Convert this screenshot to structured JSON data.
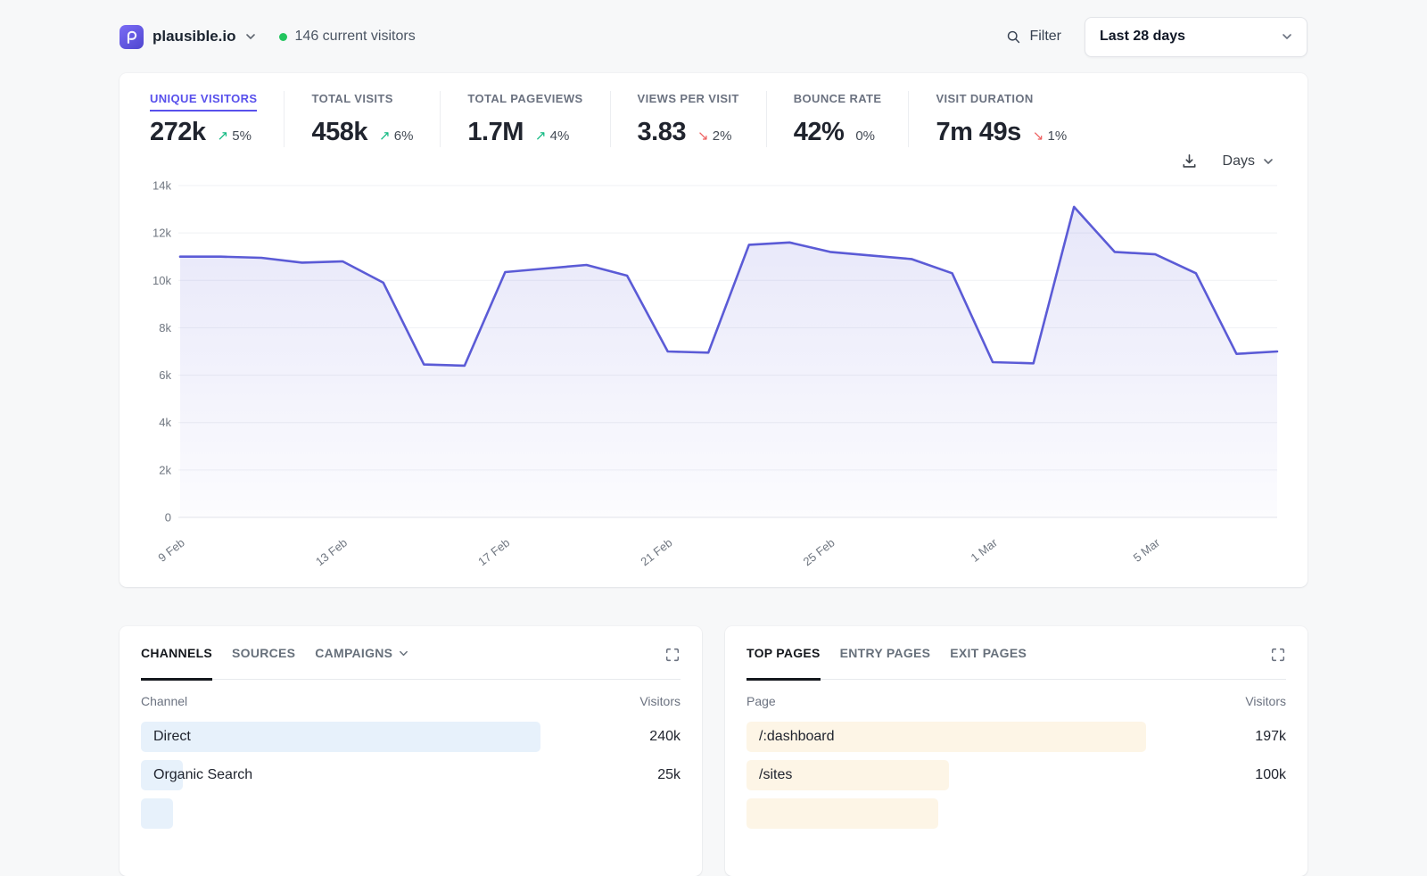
{
  "header": {
    "site_name": "plausible.io",
    "current_visitors": "146 current visitors",
    "filter_label": "Filter",
    "date_range": "Last 28 days"
  },
  "stats": [
    {
      "label": "UNIQUE VISITORS",
      "value": "272k",
      "change": "5%",
      "direction": "up",
      "active": true
    },
    {
      "label": "TOTAL VISITS",
      "value": "458k",
      "change": "6%",
      "direction": "up",
      "active": false
    },
    {
      "label": "TOTAL PAGEVIEWS",
      "value": "1.7M",
      "change": "4%",
      "direction": "up",
      "active": false
    },
    {
      "label": "VIEWS PER VISIT",
      "value": "3.83",
      "change": "2%",
      "direction": "down",
      "active": false
    },
    {
      "label": "BOUNCE RATE",
      "value": "42%",
      "change": "0%",
      "direction": "flat",
      "active": false
    },
    {
      "label": "VISIT DURATION",
      "value": "7m 49s",
      "change": "1%",
      "direction": "down",
      "active": false
    }
  ],
  "chart_toolbar": {
    "interval_label": "Days"
  },
  "chart_data": {
    "type": "area",
    "series_name": "Unique visitors",
    "x": [
      "9 Feb",
      "10 Feb",
      "11 Feb",
      "12 Feb",
      "13 Feb",
      "14 Feb",
      "15 Feb",
      "16 Feb",
      "17 Feb",
      "18 Feb",
      "19 Feb",
      "20 Feb",
      "21 Feb",
      "22 Feb",
      "23 Feb",
      "24 Feb",
      "25 Feb",
      "26 Feb",
      "27 Feb",
      "28 Feb",
      "1 Mar",
      "2 Mar",
      "3 Mar",
      "4 Mar",
      "5 Mar",
      "6 Mar",
      "7 Mar",
      "8 Mar"
    ],
    "values": [
      11000,
      11000,
      10950,
      10750,
      10800,
      9900,
      6450,
      6400,
      10350,
      10500,
      10650,
      10200,
      7000,
      6950,
      11500,
      11600,
      11200,
      11050,
      10900,
      10300,
      6550,
      6500,
      13100,
      11200,
      11100,
      10300,
      6900,
      7000
    ],
    "x_tick_labels": [
      "9 Feb",
      "13 Feb",
      "17 Feb",
      "21 Feb",
      "25 Feb",
      "1 Mar",
      "5 Mar"
    ],
    "x_tick_indices": [
      0,
      4,
      8,
      12,
      16,
      20,
      24
    ],
    "y_ticks": [
      "0",
      "2k",
      "4k",
      "6k",
      "8k",
      "10k",
      "12k",
      "14k"
    ],
    "ylim": [
      0,
      14000
    ],
    "grid": true,
    "legend": "none"
  },
  "channels_panel": {
    "tabs": [
      {
        "label": "CHANNELS",
        "active": true,
        "has_dropdown": false
      },
      {
        "label": "SOURCES",
        "active": false,
        "has_dropdown": false
      },
      {
        "label": "CAMPAIGNS",
        "active": false,
        "has_dropdown": true
      }
    ],
    "col_name": "Channel",
    "col_value": "Visitors",
    "rows": [
      {
        "name": "Direct",
        "value": "240k",
        "numeric": 240
      },
      {
        "name": "Organic Search",
        "value": "25k",
        "numeric": 25
      }
    ],
    "partial_row_fraction": 0.08,
    "max_numeric": 240,
    "bar_color": "#e7f1fb"
  },
  "pages_panel": {
    "tabs": [
      {
        "label": "TOP PAGES",
        "active": true,
        "has_dropdown": false
      },
      {
        "label": "ENTRY PAGES",
        "active": false,
        "has_dropdown": false
      },
      {
        "label": "EXIT PAGES",
        "active": false,
        "has_dropdown": false
      }
    ],
    "col_name": "Page",
    "col_value": "Visitors",
    "rows": [
      {
        "name": "/:dashboard",
        "value": "197k",
        "numeric": 197
      },
      {
        "name": "/sites",
        "value": "100k",
        "numeric": 100
      }
    ],
    "partial_row_fraction": 0.48,
    "max_numeric": 197,
    "bar_color": "#fdf5e6"
  },
  "icons": {
    "logo": "plausible-logo",
    "chevron": "chevron-down-icon",
    "search": "search-icon",
    "download": "download-icon",
    "expand": "expand-icon",
    "live_dot": "live-indicator-dot"
  },
  "colors": {
    "accent_indigo": "#5850ec",
    "line": "#5b5bd6",
    "fill_top": "rgba(91,91,214,0.15)",
    "fill_bottom": "rgba(91,91,214,0.02)",
    "green": "#10b981",
    "red": "#ee5f5f",
    "live_green": "#22c55e",
    "page_bg": "#f7f8f9",
    "card_bg": "#ffffff"
  }
}
